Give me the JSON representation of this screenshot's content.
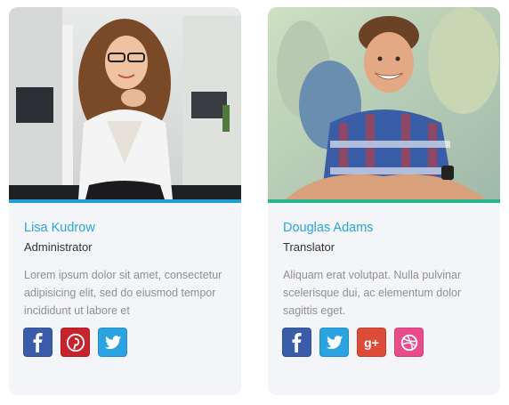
{
  "members": [
    {
      "name": "Lisa Kudrow",
      "role": "Administrator",
      "bio": "Lorem ipsum dolor sit amet, consectetur adipisicing elit, sed do eiusmod tempor incididunt ut labore et",
      "accent_color": "#1f9fd1",
      "socials": [
        "facebook-icon",
        "pinterest-icon",
        "twitter-icon"
      ]
    },
    {
      "name": "Douglas Adams",
      "role": "Translator",
      "bio": "Aliquam erat volutpat. Nulla pulvinar scelerisque dui, ac elementum dolor sagittis eget.",
      "accent_color": "#2bb38e",
      "socials": [
        "facebook-icon",
        "twitter-icon",
        "google-plus-icon",
        "dribbble-icon"
      ]
    }
  ],
  "social_colors": {
    "facebook": "#3b5ca8",
    "pinterest": "#c8232c",
    "twitter": "#2aa3e0",
    "google_plus": "#dd4b39",
    "dribbble": "#ea4c89"
  },
  "google_plus_glyph": "g+"
}
